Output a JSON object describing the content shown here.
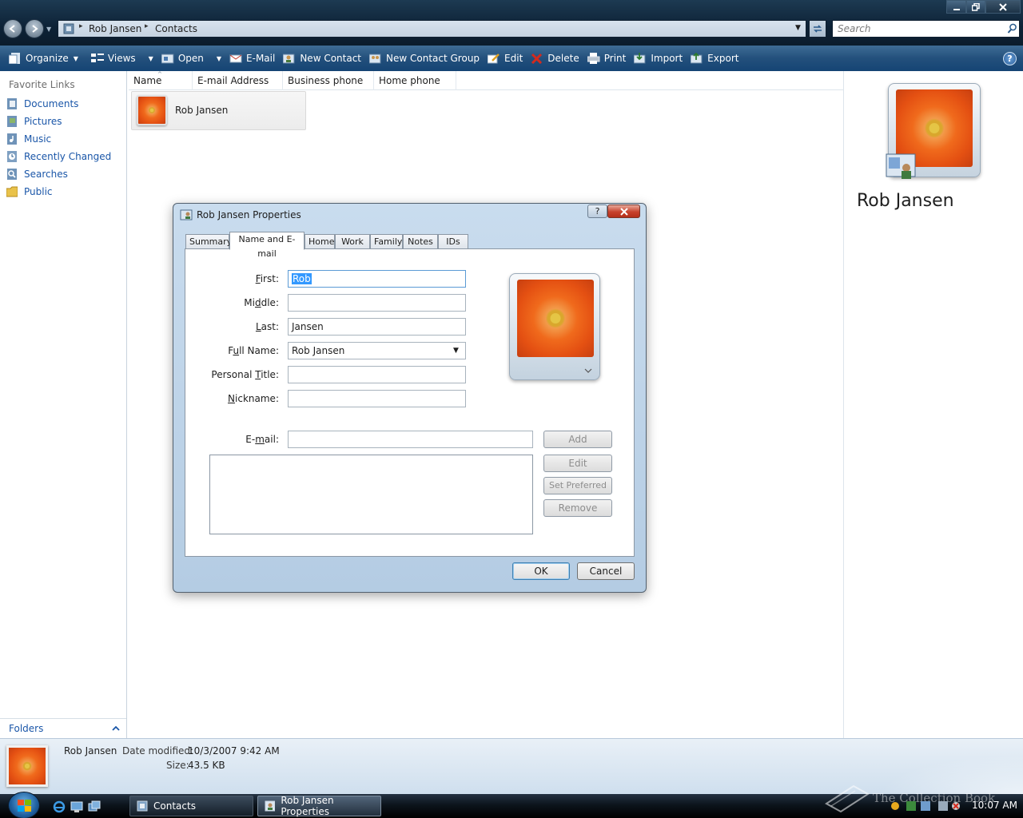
{
  "window": {
    "address": {
      "breadcrumb": [
        "Rob Jansen",
        "Contacts"
      ]
    },
    "search": {
      "placeholder": "Search"
    }
  },
  "toolbar": {
    "items": [
      {
        "label": "Organize",
        "icon": "organize-icon",
        "dropdown": true
      },
      {
        "label": "Views",
        "icon": "views-icon",
        "dropdown": true
      },
      {
        "label": "Open",
        "icon": "open-icon",
        "dropdown": true
      },
      {
        "label": "E-Mail",
        "icon": "email-icon"
      },
      {
        "label": "New Contact",
        "icon": "new-contact-icon"
      },
      {
        "label": "New Contact Group",
        "icon": "new-contact-group-icon"
      },
      {
        "label": "Edit",
        "icon": "edit-icon"
      },
      {
        "label": "Delete",
        "icon": "delete-icon"
      },
      {
        "label": "Print",
        "icon": "print-icon"
      },
      {
        "label": "Import",
        "icon": "import-icon"
      },
      {
        "label": "Export",
        "icon": "export-icon"
      }
    ]
  },
  "sidebar": {
    "heading": "Favorite Links",
    "items": [
      {
        "label": "Documents",
        "icon": "documents-icon"
      },
      {
        "label": "Pictures",
        "icon": "pictures-icon"
      },
      {
        "label": "Music",
        "icon": "music-icon"
      },
      {
        "label": "Recently Changed",
        "icon": "recently-changed-icon"
      },
      {
        "label": "Searches",
        "icon": "searches-icon"
      },
      {
        "label": "Public",
        "icon": "public-folder-icon"
      }
    ],
    "folders_label": "Folders"
  },
  "columns": [
    "Name",
    "E-mail Address",
    "Business phone",
    "Home phone"
  ],
  "contacts": [
    {
      "name": "Rob Jansen"
    }
  ],
  "preview": {
    "name": "Rob Jansen"
  },
  "details": {
    "name": "Rob Jansen",
    "modified_label": "Date modified:",
    "modified_value": "10/3/2007 9:42 AM",
    "size_label": "Size:",
    "size_value": "43.5 KB"
  },
  "dialog": {
    "title": "Rob Jansen Properties",
    "tabs": [
      "Summary",
      "Name and E-mail",
      "Home",
      "Work",
      "Family",
      "Notes",
      "IDs"
    ],
    "active_tab": "Name and E-mail",
    "fields": {
      "first": {
        "label": "First:",
        "value": "Rob"
      },
      "middle": {
        "label": "Middle:",
        "value": ""
      },
      "last": {
        "label": "Last:",
        "value": "Jansen"
      },
      "full_name": {
        "label": "Full Name:",
        "value": "Rob Jansen"
      },
      "personal_title": {
        "label": "Personal Title:",
        "value": ""
      },
      "nickname": {
        "label": "Nickname:",
        "value": ""
      },
      "email": {
        "label": "E-mail:",
        "value": ""
      }
    },
    "buttons": {
      "add": "Add",
      "edit": "Edit",
      "set_preferred": "Set Preferred",
      "remove": "Remove",
      "ok": "OK",
      "cancel": "Cancel"
    }
  },
  "taskbar": {
    "tasks": [
      "Contacts",
      "Rob Jansen Properties"
    ],
    "clock": "10:07 AM"
  },
  "watermark": "The Collection Book"
}
